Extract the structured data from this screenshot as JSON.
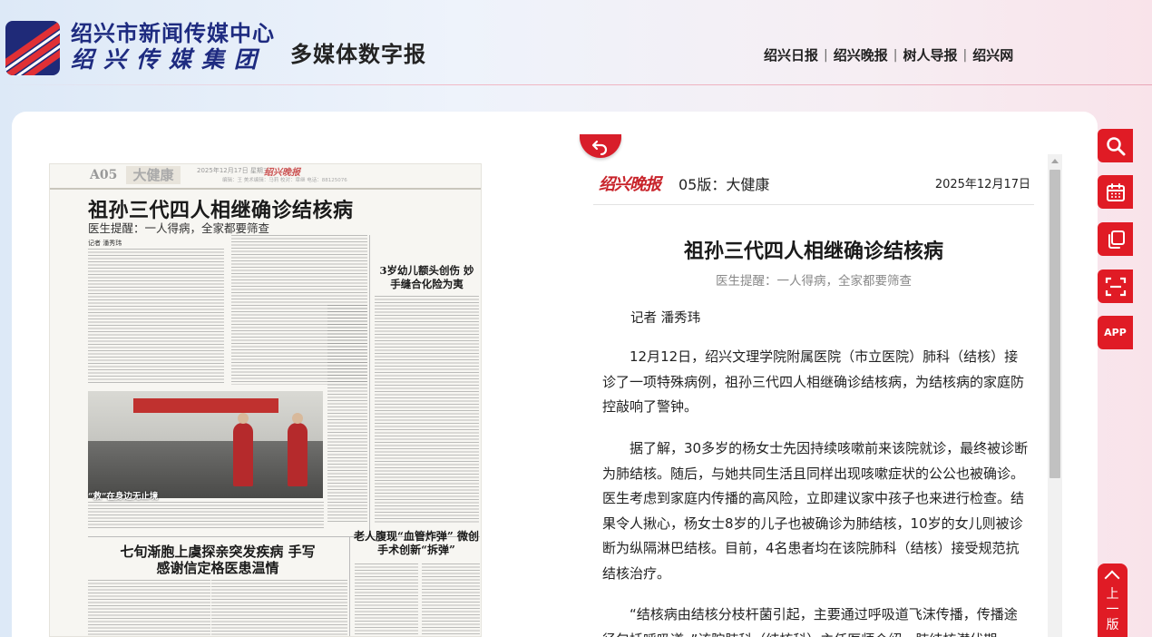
{
  "header": {
    "logo_line1": "绍兴市新闻传媒中心",
    "logo_line2": "绍兴传媒集团",
    "site_title": "多媒体数字报",
    "nav": [
      "绍兴日报",
      "绍兴晚报",
      "树人导报",
      "绍兴网"
    ]
  },
  "newspaper_page": {
    "page_no": "A05",
    "section": "大健康",
    "date_line": "2025年12月17日 星期三",
    "paper_logo": "绍兴晚报",
    "editor_line": "编辑：王 美术编辑：马莉 校对：章继 电话：88125076",
    "headline": "祖孙三代四人相继确诊结核病",
    "subhead": "医生提醒：一人得病，全家都要筛查",
    "byline": "记者 潘秀玮",
    "photo_caption": "“救”在身边无止境",
    "side_story_title": "3岁幼儿额头创伤 妙手缝合化险为夷",
    "story2_title": "七旬渐胞上虞探亲突发疾病 手写感谢信定格医患温情",
    "story3_title": "老人腹现“血管炸弹” 微创手术创新“拆弹”"
  },
  "article": {
    "paper_name": "绍兴晚报",
    "edition": "05版：大健康",
    "date": "2025年12月17日",
    "title": "祖孙三代四人相继确诊结核病",
    "subtitle": "医生提醒：一人得病，全家都要筛查",
    "author": "记者 潘秀玮",
    "paragraphs": [
      "12月12日，绍兴文理学院附属医院（市立医院）肺科（结核）接诊了一项特殊病例，祖孙三代四人相继确诊结核病，为结核病的家庭防控敲响了警钟。",
      "据了解，30多岁的杨女士先因持续咳嗽前来该院就诊，最终被诊断为肺结核。随后，与她共同生活且同样出现咳嗽症状的公公也被确诊。医生考虑到家庭内传播的高风险，立即建议家中孩子也来进行检查。结果令人揪心，杨女士8岁的儿子也被确诊为肺结核，10岁的女儿则被诊断为纵隔淋巴结核。目前，4名患者均在该院肺科（结核）接受规范抗结核治疗。",
      "“结核病由结核分枝杆菌引起，主要通过呼吸道飞沫传播，传播途径包括呼吸道。”该院肺科（结核科）主任医师介绍，肺结核潜伏期"
    ]
  },
  "tools": {
    "search": "search-icon",
    "calendar": "calendar-icon",
    "copy": "copy-icon",
    "scan": "scan-icon",
    "app_label": "APP",
    "prev_page_label": "上一版"
  },
  "colors": {
    "brand_red": "#e01b25",
    "logo_blue": "#1e2b80"
  }
}
